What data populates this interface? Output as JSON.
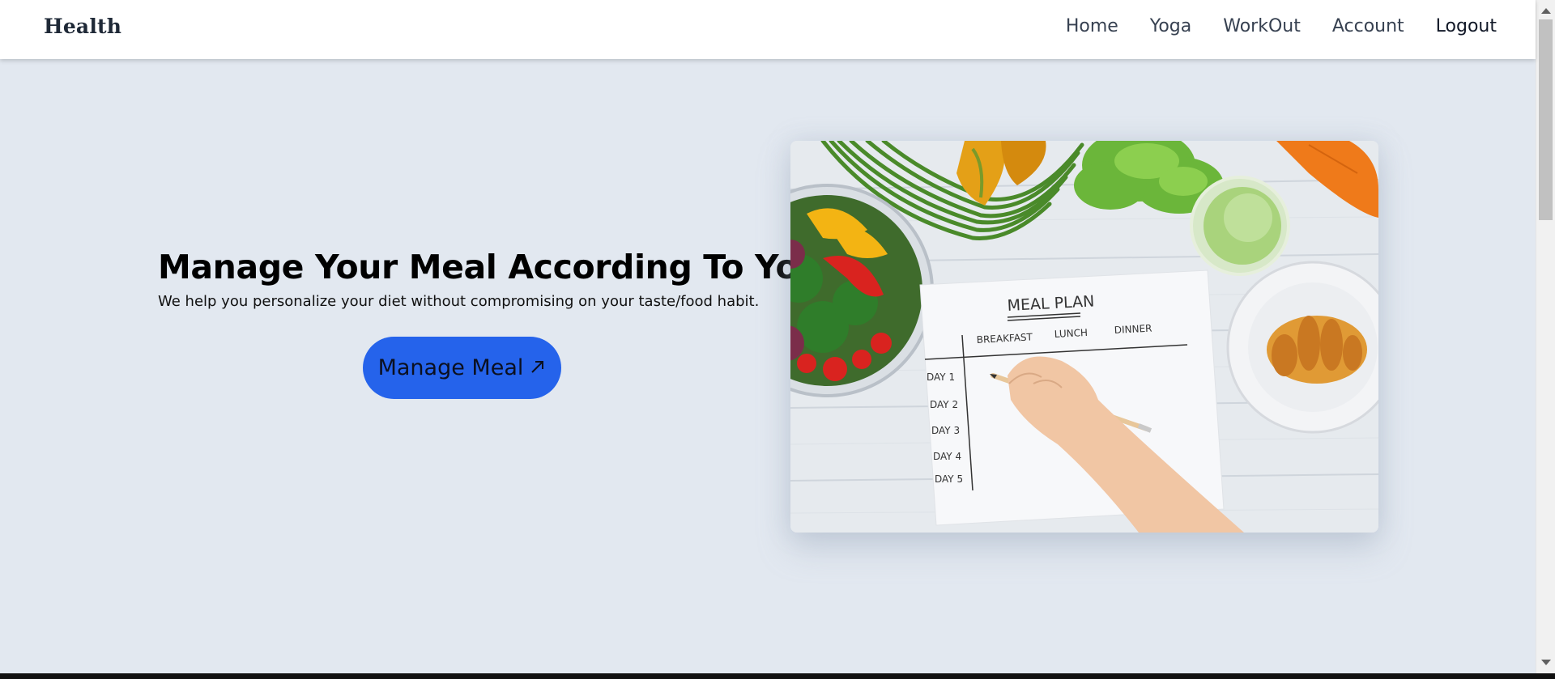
{
  "navbar": {
    "brand": "Health",
    "links": [
      {
        "label": "Home"
      },
      {
        "label": "Yoga"
      },
      {
        "label": "WorkOut"
      },
      {
        "label": "Account"
      },
      {
        "label": "Logout"
      }
    ]
  },
  "hero": {
    "title": "Manage Your Meal According To You",
    "subtitle": "We help you personalize your diet without compromising on your taste/food habit.",
    "button_label": "Manage Meal",
    "button_icon": "arrow-up-right-icon",
    "image": {
      "heading": "MEAL PLAN",
      "columns": [
        "BREAKFAST",
        "LUNCH",
        "DINNER"
      ],
      "rows": [
        "DAY 1",
        "DAY 2",
        "DAY 3",
        "DAY 4",
        "DAY 5"
      ]
    }
  },
  "colors": {
    "page_bg": "#e2e8f0",
    "navbar_bg": "#ffffff",
    "button_bg": "#2563eb",
    "brand_text": "#1f2937"
  }
}
